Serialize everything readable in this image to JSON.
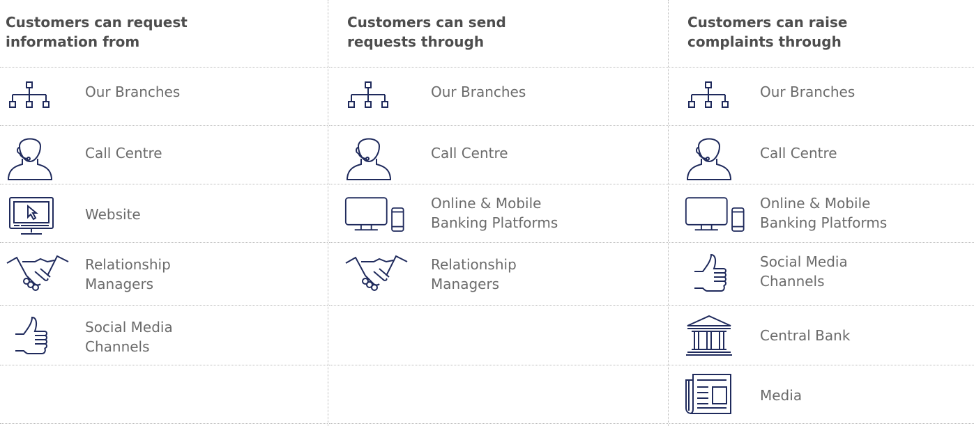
{
  "columns": [
    {
      "header": "Customers can request\ninformation from",
      "items": [
        {
          "label": "Our Branches",
          "icon": "branch-network-icon"
        },
        {
          "label": "Call Centre",
          "icon": "headset-agent-icon"
        },
        {
          "label": "Website",
          "icon": "monitor-cursor-icon"
        },
        {
          "label": "Relationship\nManagers",
          "icon": "handshake-icon"
        },
        {
          "label": "Social Media\nChannels",
          "icon": "thumbs-up-icon"
        }
      ]
    },
    {
      "header": "Customers can send\nrequests through",
      "items": [
        {
          "label": "Our Branches",
          "icon": "branch-network-icon"
        },
        {
          "label": "Call Centre",
          "icon": "headset-agent-icon"
        },
        {
          "label": "Online & Mobile\nBanking Platforms",
          "icon": "monitor-phone-icon"
        },
        {
          "label": "Relationship\nManagers",
          "icon": "handshake-icon"
        }
      ]
    },
    {
      "header": "Customers can raise\ncomplaints through",
      "items": [
        {
          "label": "Our Branches",
          "icon": "branch-network-icon"
        },
        {
          "label": "Call Centre",
          "icon": "headset-agent-icon"
        },
        {
          "label": "Online & Mobile\nBanking Platforms",
          "icon": "monitor-phone-icon"
        },
        {
          "label": "Social Media\nChannels",
          "icon": "thumbs-up-icon"
        },
        {
          "label": "Central Bank",
          "icon": "bank-building-icon"
        },
        {
          "label": "Media",
          "icon": "newspaper-icon"
        }
      ]
    }
  ],
  "colors": {
    "icon": "#1f2a5c",
    "text": "#6b6b6b",
    "header": "#4d4d4d",
    "divider": "#b9b9b9"
  }
}
